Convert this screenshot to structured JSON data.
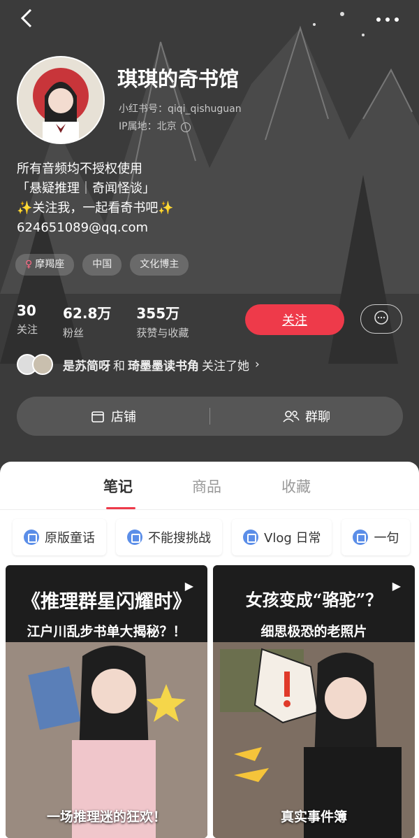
{
  "profile": {
    "nickname": "琪琪的奇书馆",
    "red_id": "小红书号：qiqi_qishuguan",
    "ip": "IP属地：北京",
    "bio_lines": [
      "所有音频均不授权使用",
      "「悬疑推理｜奇闻怪谈」",
      "✨关注我，一起看奇书吧✨",
      "624651089@qq.com"
    ],
    "tags": [
      "摩羯座",
      "中国",
      "文化博主"
    ],
    "stats": [
      {
        "num": "30",
        "label": "关注"
      },
      {
        "num": "62.8万",
        "label": "粉丝"
      },
      {
        "num": "355万",
        "label": "获赞与收藏"
      }
    ],
    "follow_label": "关注",
    "followers_line": {
      "name1": "是苏简呀",
      "and": "和",
      "name2": "琦墨墨读书角",
      "suffix": "关注了她"
    },
    "shop_label": "店铺",
    "group_label": "群聊"
  },
  "tabs": [
    "笔记",
    "商品",
    "收藏"
  ],
  "collections": [
    "原版童话",
    "不能搜挑战",
    "Vlog 日常",
    "一句"
  ],
  "notes": [
    {
      "title": "《推理群星闪耀时》",
      "subtitle": "江户川乱步书单大揭秘？！",
      "caption": "一场推理迷的狂欢！"
    },
    {
      "title": "女孩变成“骆驼”？",
      "subtitle": "细思极恐的老照片",
      "caption": "真实事件簿"
    }
  ],
  "colors": {
    "accent": "#ee3a4a",
    "header_bg": "#3a3a3a",
    "collection_icon": "#5b8ee8"
  }
}
